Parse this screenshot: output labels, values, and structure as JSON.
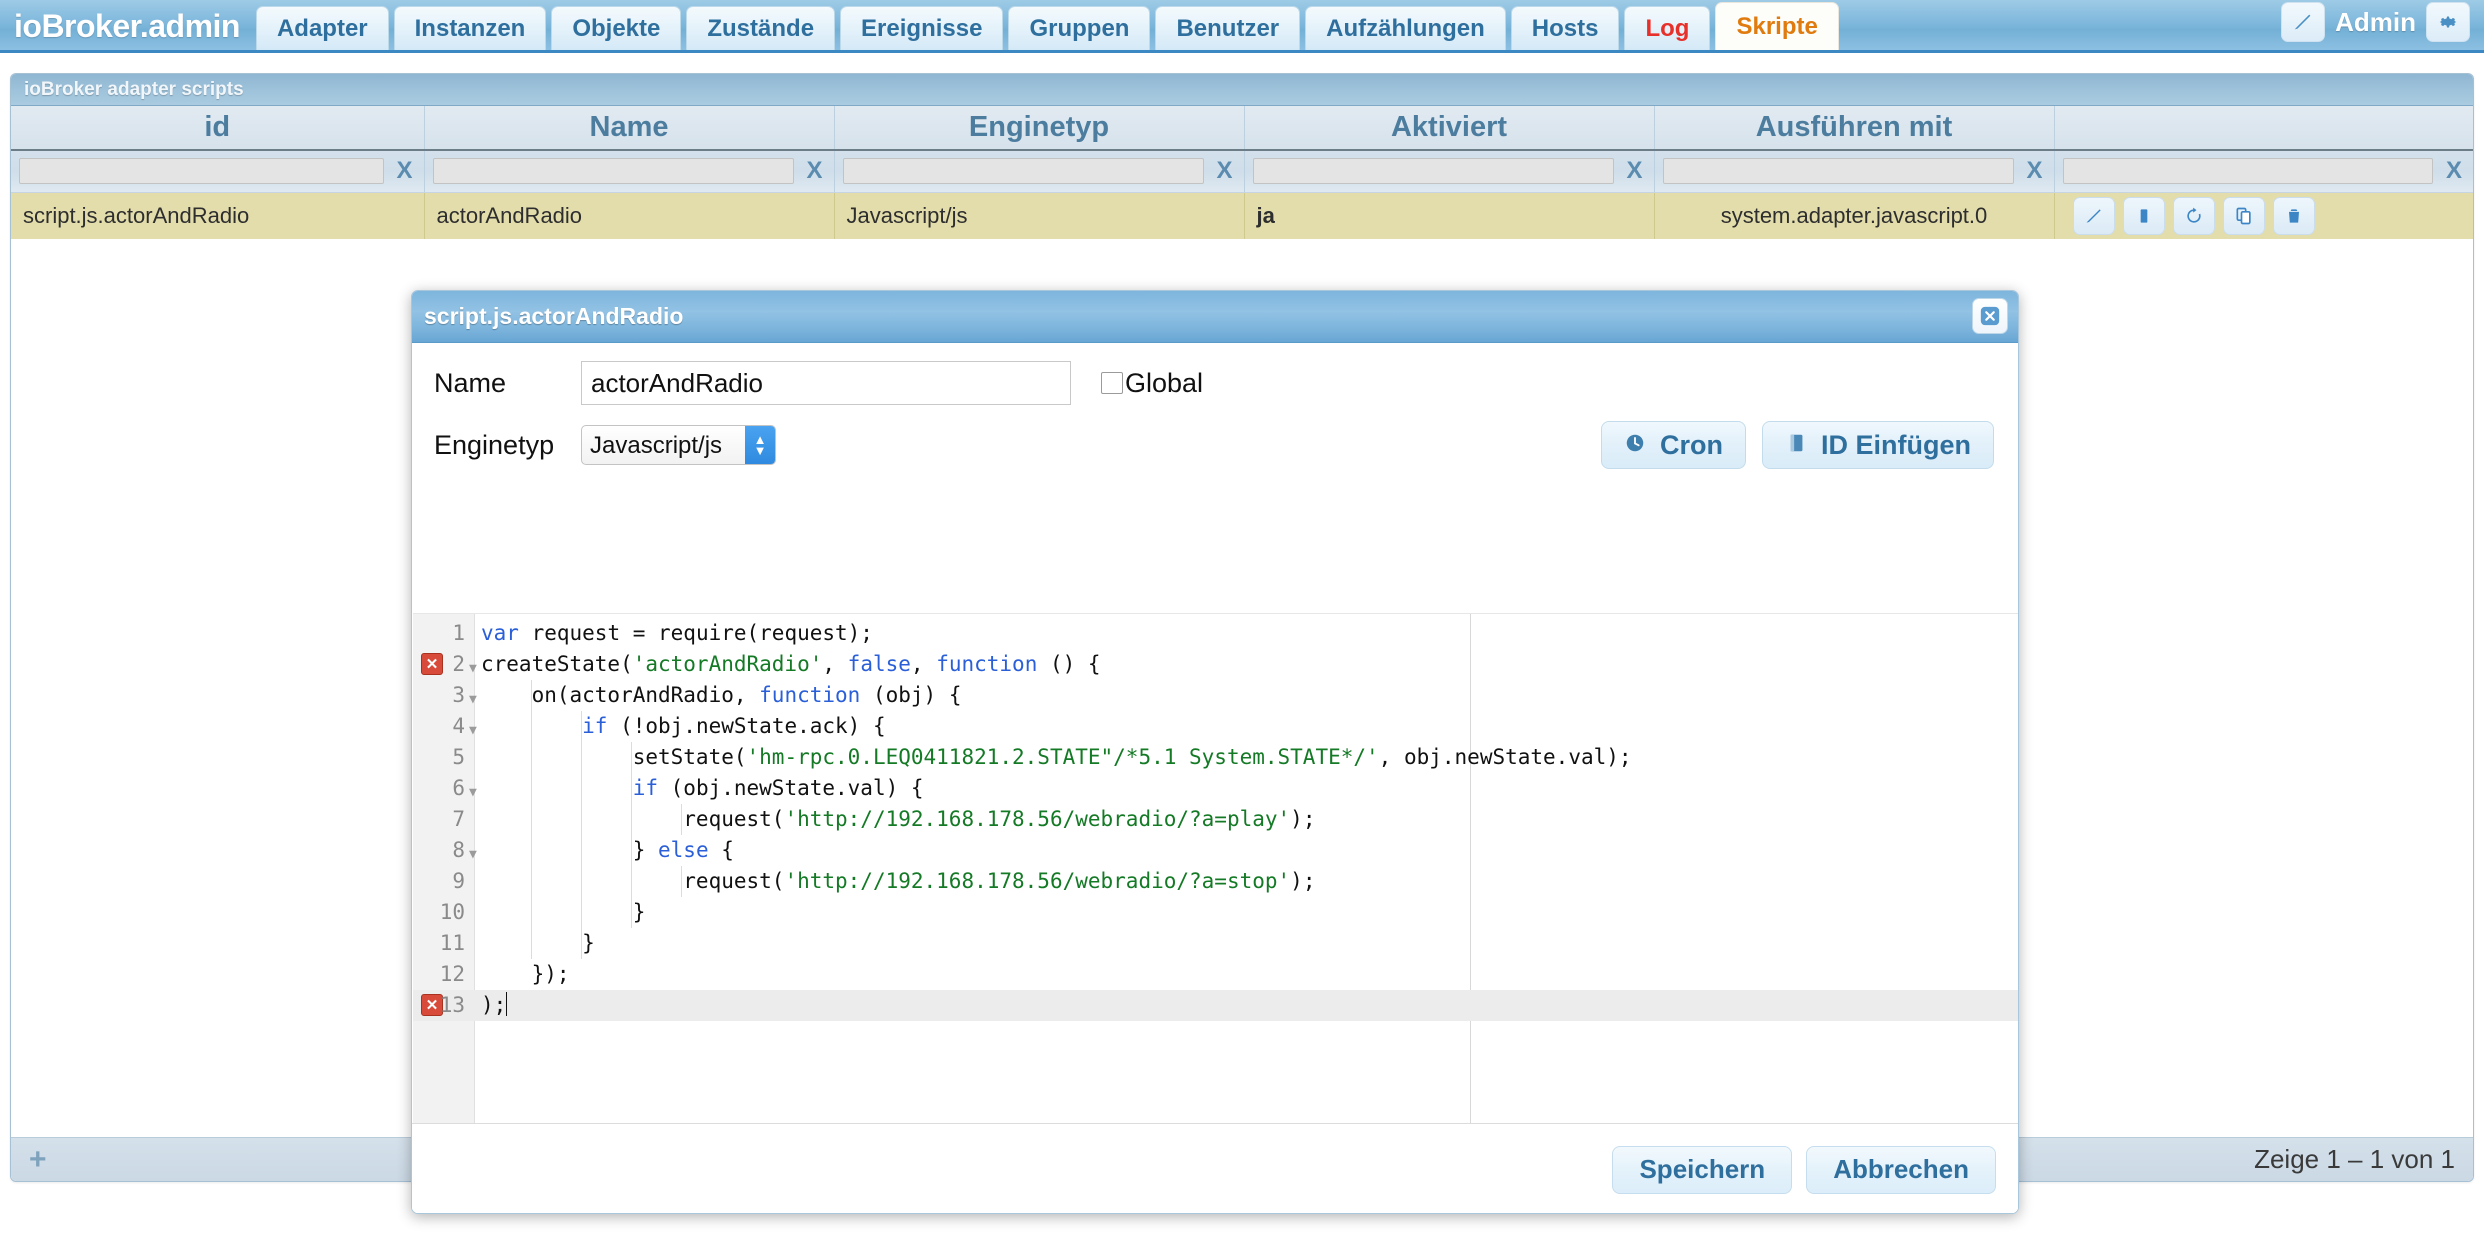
{
  "app": {
    "brand": "ioBroker.admin",
    "user": "Admin",
    "edit_icon": "pencil-icon",
    "settings_icon": "gear-icon"
  },
  "nav": {
    "tabs": [
      {
        "label": "Adapter",
        "state": "normal"
      },
      {
        "label": "Instanzen",
        "state": "normal"
      },
      {
        "label": "Objekte",
        "state": "normal"
      },
      {
        "label": "Zustände",
        "state": "normal"
      },
      {
        "label": "Ereignisse",
        "state": "normal"
      },
      {
        "label": "Gruppen",
        "state": "normal"
      },
      {
        "label": "Benutzer",
        "state": "normal"
      },
      {
        "label": "Aufzählungen",
        "state": "normal"
      },
      {
        "label": "Hosts",
        "state": "normal"
      },
      {
        "label": "Log",
        "state": "red"
      },
      {
        "label": "Skripte",
        "state": "active"
      }
    ]
  },
  "panel": {
    "title": "ioBroker adapter scripts",
    "columns": [
      "id",
      "Name",
      "Enginetyp",
      "Aktiviert",
      "Ausführen mit",
      ""
    ],
    "filters": {
      "values": [
        "",
        "",
        "",
        "",
        "",
        ""
      ],
      "clear_label": "X"
    },
    "rows": [
      {
        "id": "script.js.actorAndRadio",
        "name": "actorAndRadio",
        "enginetyp": "Javascript/js",
        "aktiviert": "ja",
        "ausfuehren_mit": "system.adapter.javascript.0",
        "actions": [
          "pencil-icon",
          "stop-icon",
          "restart-icon",
          "copy-icon",
          "trash-icon"
        ]
      }
    ],
    "footer": {
      "add_label": "+",
      "page_info": "Zeige 1 – 1 von 1"
    }
  },
  "dialog": {
    "title": "script.js.actorAndRadio",
    "close_label": "✖",
    "name_label": "Name",
    "name_value": "actorAndRadio",
    "global_label": "Global",
    "global_checked": false,
    "enginetyp_label": "Enginetyp",
    "enginetyp_value": "Javascript/js",
    "enginetyp_options": [
      "Javascript/js"
    ],
    "cron_button": "Cron",
    "cron_icon": "clock-icon",
    "insert_id_button": "ID Einfügen",
    "insert_id_icon": "book-icon",
    "save_button": "Speichern",
    "cancel_button": "Abbrechen"
  },
  "editor": {
    "current_line": 13,
    "error_lines": [
      2,
      13
    ],
    "lines": [
      {
        "no": "1",
        "fold": false,
        "error": false,
        "tokens": [
          {
            "t": "k",
            "v": "var"
          },
          {
            "t": "n",
            "v": " request = require(request);"
          }
        ]
      },
      {
        "no": "2",
        "fold": true,
        "error": true,
        "tokens": [
          {
            "t": "n",
            "v": "createState("
          },
          {
            "t": "s",
            "v": "'actorAndRadio'"
          },
          {
            "t": "n",
            "v": ", "
          },
          {
            "t": "k",
            "v": "false"
          },
          {
            "t": "n",
            "v": ", "
          },
          {
            "t": "k",
            "v": "function"
          },
          {
            "t": "n",
            "v": " () {"
          }
        ]
      },
      {
        "no": "3",
        "fold": true,
        "error": false,
        "tokens": [
          {
            "t": "n",
            "v": "    on(actorAndRadio, "
          },
          {
            "t": "k",
            "v": "function"
          },
          {
            "t": "n",
            "v": " (obj) {"
          }
        ]
      },
      {
        "no": "4",
        "fold": true,
        "error": false,
        "tokens": [
          {
            "t": "n",
            "v": "        "
          },
          {
            "t": "k",
            "v": "if"
          },
          {
            "t": "n",
            "v": " (!obj.newState.ack) {"
          }
        ]
      },
      {
        "no": "5",
        "fold": false,
        "error": false,
        "tokens": [
          {
            "t": "n",
            "v": "            setState("
          },
          {
            "t": "s",
            "v": "'hm-rpc.0.LEQ0411821.2.STATE\"/*5.1 System.STATE*/'"
          },
          {
            "t": "n",
            "v": ", obj.newState.val);"
          }
        ]
      },
      {
        "no": "6",
        "fold": true,
        "error": false,
        "tokens": [
          {
            "t": "n",
            "v": "            "
          },
          {
            "t": "k",
            "v": "if"
          },
          {
            "t": "n",
            "v": " (obj.newState.val) {"
          }
        ]
      },
      {
        "no": "7",
        "fold": false,
        "error": false,
        "tokens": [
          {
            "t": "n",
            "v": "                request("
          },
          {
            "t": "s",
            "v": "'http://192.168.178.56/webradio/?a=play'"
          },
          {
            "t": "n",
            "v": ");"
          }
        ]
      },
      {
        "no": "8",
        "fold": true,
        "error": false,
        "tokens": [
          {
            "t": "n",
            "v": "            } "
          },
          {
            "t": "k",
            "v": "else"
          },
          {
            "t": "n",
            "v": " {"
          }
        ]
      },
      {
        "no": "9",
        "fold": false,
        "error": false,
        "tokens": [
          {
            "t": "n",
            "v": "                request("
          },
          {
            "t": "s",
            "v": "'http://192.168.178.56/webradio/?a=stop'"
          },
          {
            "t": "n",
            "v": ");"
          }
        ]
      },
      {
        "no": "10",
        "fold": false,
        "error": false,
        "tokens": [
          {
            "t": "n",
            "v": "            }"
          }
        ]
      },
      {
        "no": "11",
        "fold": false,
        "error": false,
        "tokens": [
          {
            "t": "n",
            "v": "        }"
          }
        ]
      },
      {
        "no": "12",
        "fold": false,
        "error": false,
        "tokens": [
          {
            "t": "n",
            "v": "    });"
          }
        ]
      },
      {
        "no": "13",
        "fold": false,
        "error": true,
        "tokens": [
          {
            "t": "n",
            "v": ");"
          }
        ]
      }
    ]
  },
  "colors": {
    "brand_blue": "#3b88c3",
    "tab_active_text": "#e07b10",
    "tab_log_text": "#e8302a",
    "row_highlight": "#e3ddab",
    "enabled_green": "#1d7a1d",
    "string_green": "#157a26",
    "keyword_blue": "#2a5fd8",
    "error_red": "#d84a3a"
  }
}
